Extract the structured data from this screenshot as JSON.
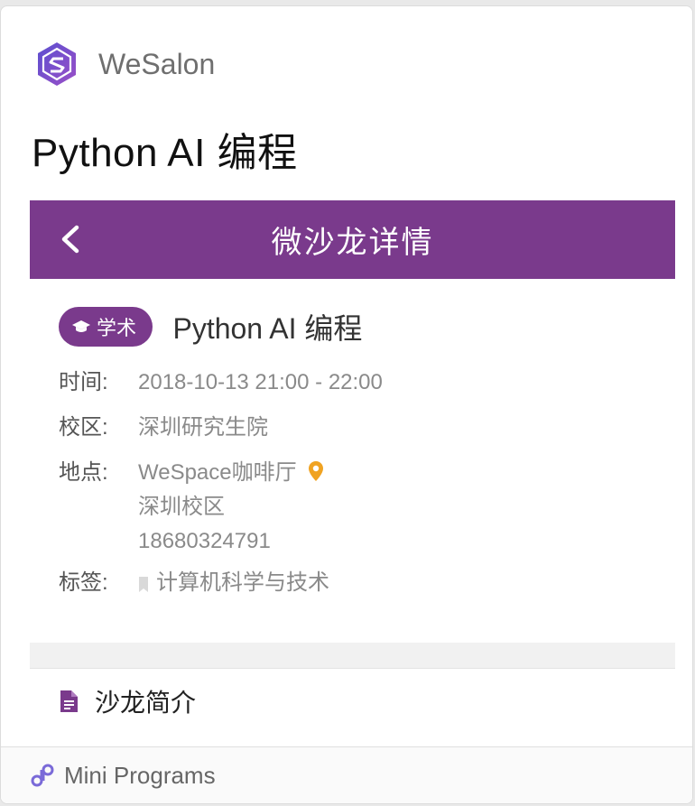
{
  "header": {
    "app_name": "WeSalon",
    "page_title": "Python AI 编程"
  },
  "navbar": {
    "title": "微沙龙详情",
    "back_icon": "chevron-left-icon"
  },
  "event": {
    "badge": "学术",
    "title": "Python AI 编程",
    "time_label": "时间:",
    "time_value": "2018-10-13 21:00 - 22:00",
    "campus_label": "校区:",
    "campus_value": "深圳研究生院",
    "location_label": "地点:",
    "location_lines": [
      "WeSpace咖啡厅",
      "深圳校区",
      "18680324791"
    ],
    "tags_label": "标签:",
    "tag_value": "计算机科学与技术"
  },
  "section": {
    "title": "沙龙简介"
  },
  "footer": {
    "label": "Mini Programs"
  },
  "colors": {
    "brand_purple": "#7a3a8c",
    "pin_orange": "#f0a322"
  }
}
